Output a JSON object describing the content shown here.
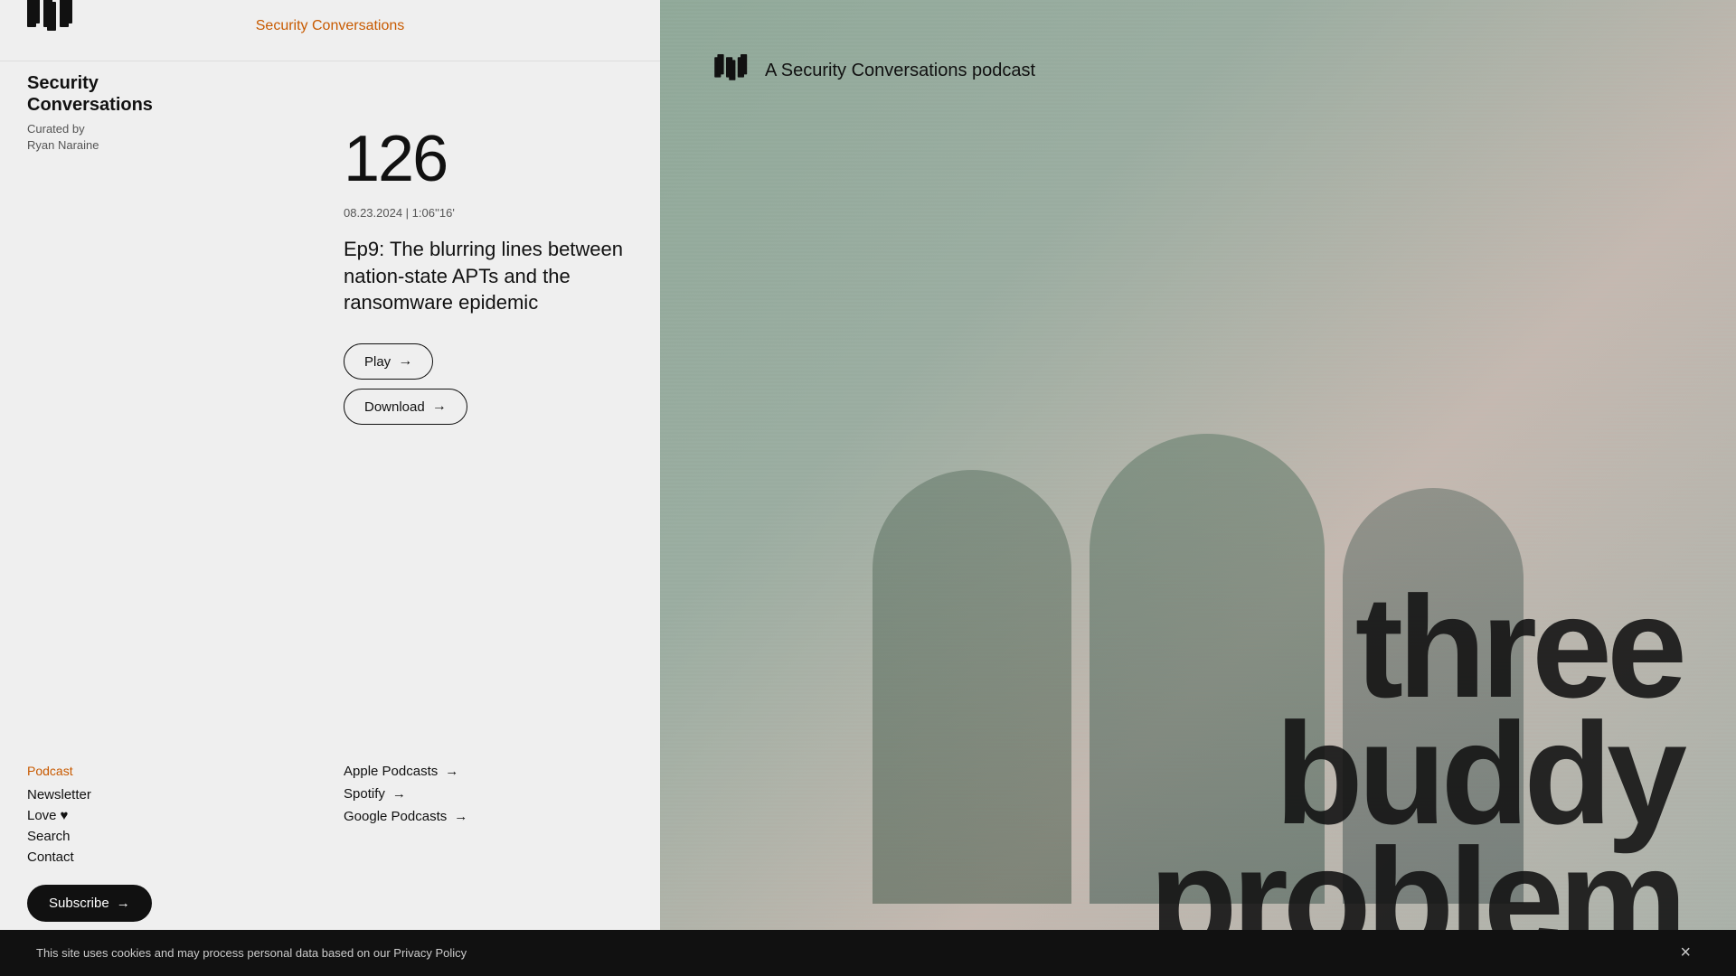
{
  "brand": {
    "name": "Security Conversations",
    "logo_symbol": "⟦⟧",
    "logo_unicode": "❲❳",
    "curator_label": "Curated by",
    "curator_name": "Ryan Naraine",
    "sidebar_title_line1": "Security",
    "sidebar_title_line2": "Conversations"
  },
  "header": {
    "brand_link": "Security Conversations"
  },
  "episode": {
    "number": "126",
    "date": "08.23.2024",
    "duration": "1:06''16'",
    "meta": "08.23.2024 | 1:06''16'",
    "title": "Ep9: The blurring lines between nation-state APTs and the ransomware epidemic"
  },
  "buttons": {
    "play_label": "Play",
    "download_label": "Download",
    "subscribe_label": "Subscribe",
    "arrow": "→"
  },
  "nav": {
    "podcast_section": "Podcast",
    "newsletter": "Newsletter",
    "love": "Love",
    "love_icon": "♥",
    "search": "Search",
    "contact": "Contact"
  },
  "platforms": {
    "apple": "Apple Podcasts",
    "spotify": "Spotify",
    "google": "Google Podcasts",
    "arrow": "→"
  },
  "podcast_cover": {
    "logo_text": "❲❳",
    "tagline": "A Security Conversations podcast",
    "big_text_line1": "three",
    "big_text_line2": "buddy",
    "big_text_line3": "problem"
  },
  "cookie": {
    "message": "This site uses cookies and may process personal data based on our Privacy Policy",
    "close_label": "×"
  },
  "colors": {
    "accent": "#c85a00",
    "dark": "#111111",
    "mid": "#555555",
    "light_bg": "#efefef"
  }
}
